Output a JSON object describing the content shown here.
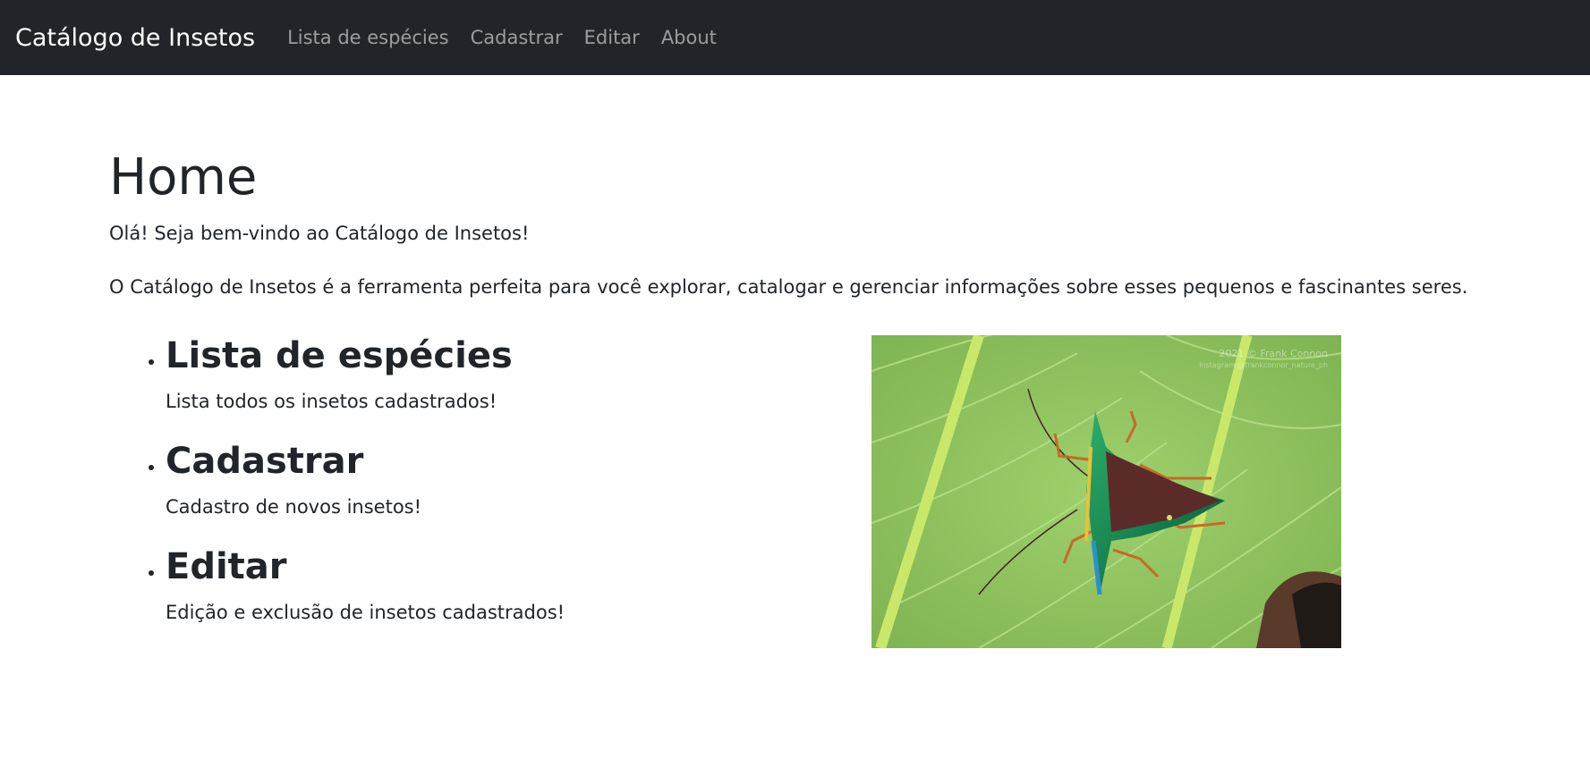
{
  "navbar": {
    "brand": "Catálogo de Insetos",
    "links": [
      "Lista de espécies",
      "Cadastrar",
      "Editar",
      "About"
    ]
  },
  "main": {
    "title": "Home",
    "welcome": "Olá! Seja bem-vindo ao Catálogo de Insetos!",
    "intro": "O Catálogo de Insetos é a ferramenta perfeita para você explorar, catalogar e gerenciar informações sobre esses pequenos e fascinantes seres.",
    "features": [
      {
        "title": "Lista de espécies",
        "desc": "Lista todos os insetos cadastrados!"
      },
      {
        "title": "Cadastrar",
        "desc": "Cadastro de novos insetos!"
      },
      {
        "title": "Editar",
        "desc": "Edição e exclusão de insetos cadastrados!"
      }
    ],
    "image": {
      "watermark_line1": "2021 © Frank Connon",
      "watermark_line2": "Instagram @frankconnor_nature_ph"
    }
  }
}
